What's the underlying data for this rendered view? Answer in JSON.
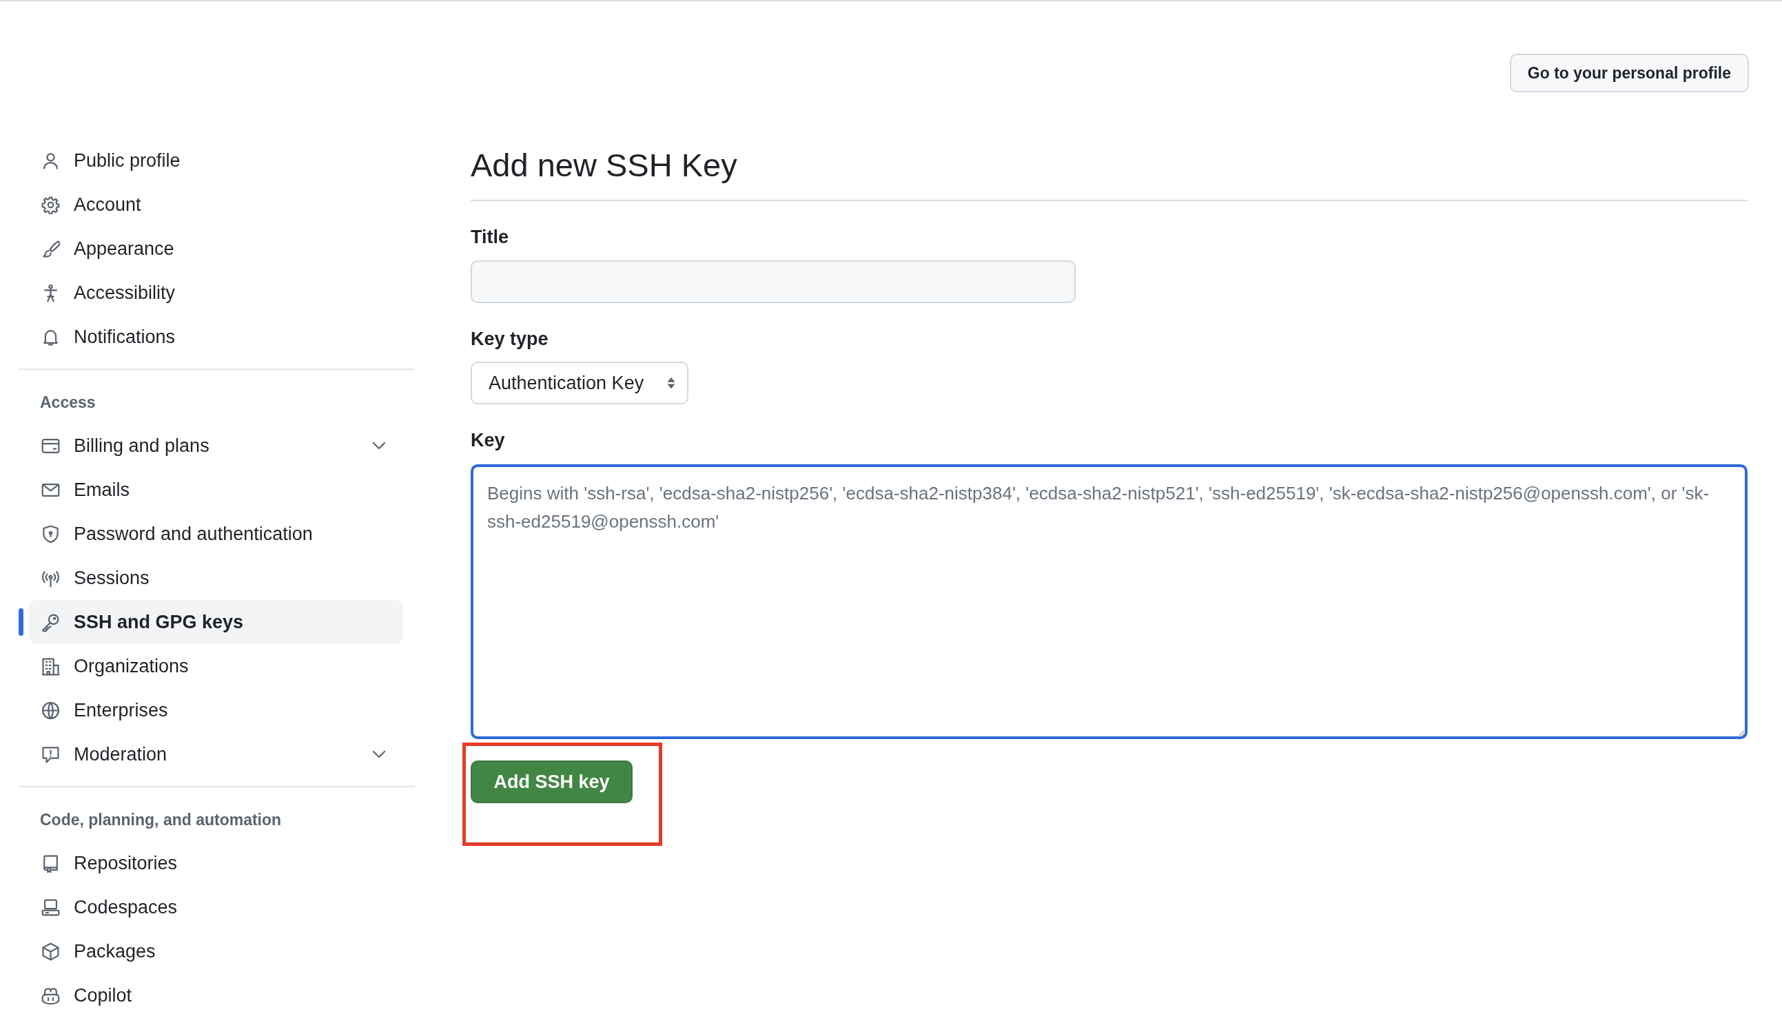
{
  "header": {
    "profile_button": "Go to your personal profile"
  },
  "sidebar": {
    "groups": [
      {
        "items": [
          {
            "label": "Public profile",
            "selected": false,
            "expandable": false
          },
          {
            "label": "Account",
            "selected": false,
            "expandable": false
          },
          {
            "label": "Appearance",
            "selected": false,
            "expandable": false
          },
          {
            "label": "Accessibility",
            "selected": false,
            "expandable": false
          },
          {
            "label": "Notifications",
            "selected": false,
            "expandable": false
          }
        ]
      },
      {
        "heading": "Access",
        "items": [
          {
            "label": "Billing and plans",
            "selected": false,
            "expandable": true
          },
          {
            "label": "Emails",
            "selected": false,
            "expandable": false
          },
          {
            "label": "Password and authentication",
            "selected": false,
            "expandable": false
          },
          {
            "label": "Sessions",
            "selected": false,
            "expandable": false
          },
          {
            "label": "SSH and GPG keys",
            "selected": true,
            "expandable": false
          },
          {
            "label": "Organizations",
            "selected": false,
            "expandable": false
          },
          {
            "label": "Enterprises",
            "selected": false,
            "expandable": false
          },
          {
            "label": "Moderation",
            "selected": false,
            "expandable": true
          }
        ]
      },
      {
        "heading": "Code, planning, and automation",
        "items": [
          {
            "label": "Repositories",
            "selected": false,
            "expandable": false
          },
          {
            "label": "Codespaces",
            "selected": false,
            "expandable": false
          },
          {
            "label": "Packages",
            "selected": false,
            "expandable": false
          },
          {
            "label": "Copilot",
            "selected": false,
            "expandable": false
          }
        ]
      }
    ]
  },
  "form": {
    "heading": "Add new SSH Key",
    "title_field": {
      "label": "Title"
    },
    "key_type": {
      "label": "Key type",
      "value": "Authentication Key"
    },
    "key_field": {
      "label": "Key",
      "placeholder": "Begins with 'ssh-rsa', 'ecdsa-sha2-nistp256', 'ecdsa-sha2-nistp384', 'ecdsa-sha2-nistp521', 'ssh-ed25519', 'sk-ecdsa-sha2-nistp256@openssh.com', or 'sk-ssh-ed25519@openssh.com'"
    },
    "submit": {
      "label": "Add SSH key",
      "highlighted": true
    }
  }
}
